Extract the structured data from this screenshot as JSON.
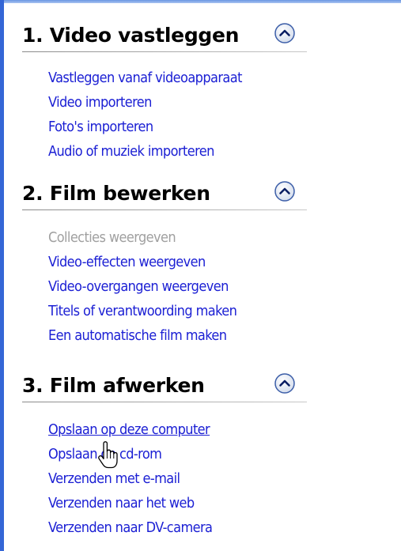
{
  "colors": {
    "link": "#1c20d4",
    "disabled": "#a0a0a0",
    "heading": "#000000",
    "border_accent": "#3466d6"
  },
  "sections": [
    {
      "title": "1. Video vastleggen",
      "toggle_icon": "collapse-up-icon",
      "tasks": [
        {
          "label": "Vastleggen vanaf videoapparaat",
          "enabled": true
        },
        {
          "label": "Video importeren",
          "enabled": true
        },
        {
          "label": "Foto's importeren",
          "enabled": true
        },
        {
          "label": "Audio of muziek importeren",
          "enabled": true
        }
      ]
    },
    {
      "title": "2. Film bewerken",
      "toggle_icon": "collapse-up-icon",
      "tasks": [
        {
          "label": "Collecties weergeven",
          "enabled": false
        },
        {
          "label": "Video-effecten weergeven",
          "enabled": true
        },
        {
          "label": "Video-overgangen weergeven",
          "enabled": true
        },
        {
          "label": "Titels of verantwoording maken",
          "enabled": true
        },
        {
          "label": "Een automatische film maken",
          "enabled": true
        }
      ]
    },
    {
      "title": "3. Film afwerken",
      "toggle_icon": "collapse-up-icon",
      "tasks": [
        {
          "label": "Opslaan op deze computer",
          "enabled": true,
          "hovered": true
        },
        {
          "label": "Opslaan op cd-rom",
          "enabled": true
        },
        {
          "label": "Verzenden met e-mail",
          "enabled": true
        },
        {
          "label": "Verzenden naar het web",
          "enabled": true
        },
        {
          "label": "Verzenden naar DV-camera",
          "enabled": true
        }
      ]
    }
  ],
  "cursor_icon": "hand-pointer-icon"
}
